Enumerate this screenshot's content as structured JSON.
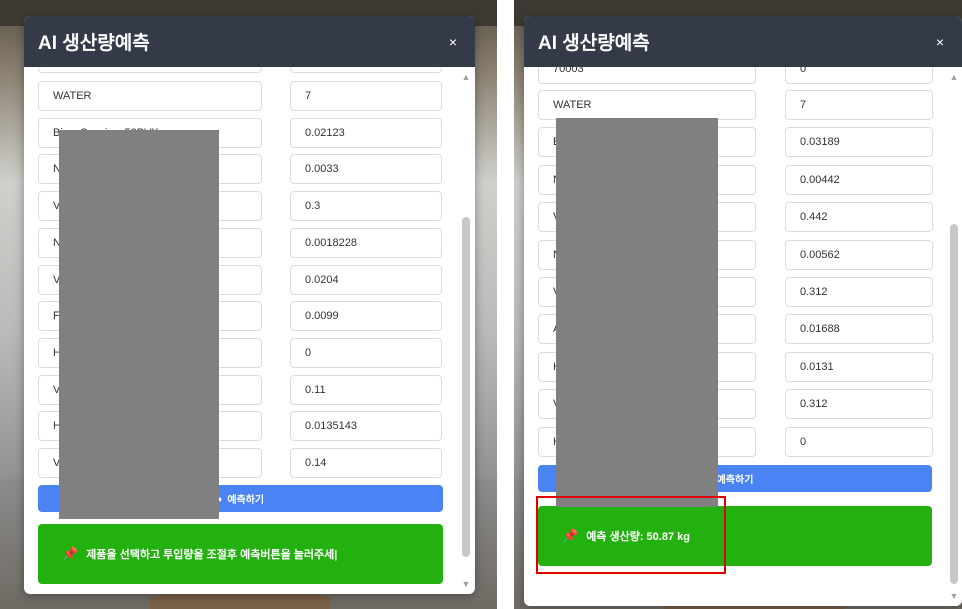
{
  "left_panel": {
    "title": "AI 생산량예측",
    "close_label": "×",
    "top_partial_row": {
      "name": "",
      "value": ""
    },
    "rows": [
      {
        "name": "WATER",
        "value": "7"
      },
      {
        "name": "Bi  —  C  —  i  —  52PVK",
        "value": "0.02123"
      },
      {
        "name": "N",
        "value": "0.0033"
      },
      {
        "name": "V",
        "value": "0.3"
      },
      {
        "name": "N",
        "value": "0.0018228"
      },
      {
        "name": "V",
        "value": "0.0204"
      },
      {
        "name": "F",
        "value": "0.0099"
      },
      {
        "name": "H",
        "value": "0"
      },
      {
        "name": "V",
        "value": "0.11"
      },
      {
        "name": "H",
        "value": "0.0135143"
      },
      {
        "name": "V",
        "value": "0.14"
      }
    ],
    "predict_button": "예측하기",
    "predict_icon": "circle-icon",
    "result_icon": "pushpin-icon",
    "result_pin": "📌",
    "result_text": "제품을 선택하고 투입량을 조절후 예측버튼을 눌러주세|"
  },
  "right_panel": {
    "title": "AI 생산량예측",
    "close_label": "×",
    "top_partial_row": {
      "name": "70003",
      "value": "0"
    },
    "rows": [
      {
        "name": "WATER",
        "value": "7"
      },
      {
        "name": "B",
        "value": "0.03189"
      },
      {
        "name": "N",
        "value": "0.00442"
      },
      {
        "name": "V",
        "value": "0.442"
      },
      {
        "name": "N",
        "value": "0.00562"
      },
      {
        "name": "V",
        "value": "0.312"
      },
      {
        "name": "A",
        "value": "0.01688"
      },
      {
        "name": "H",
        "value": "0.0131"
      },
      {
        "name": "V",
        "value": "0.312"
      },
      {
        "name": "H",
        "value": "0"
      }
    ],
    "predict_button": "예측하기",
    "result_icon": "pushpin-icon",
    "result_pin": "📌",
    "result_text": "예측 생산량: 50.87 kg"
  },
  "colors": {
    "header": "#343a48",
    "predict_button": "#4a84f4",
    "result_box": "#22b10e",
    "highlight": "#e00000",
    "redaction": "#808080"
  }
}
